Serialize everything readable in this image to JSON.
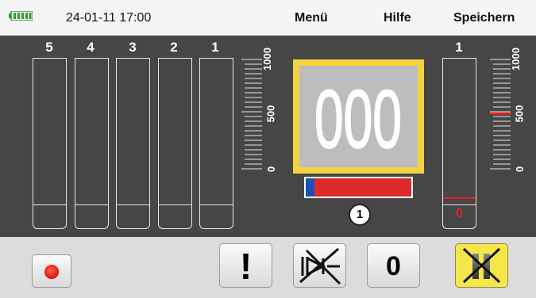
{
  "header": {
    "battery_icon": "battery-icon",
    "datetime": "24-01-11 17:00",
    "menu_label": "Menü",
    "help_label": "Hilfe",
    "save_label": "Speichern"
  },
  "left_panel": {
    "channels": [
      {
        "label": "5"
      },
      {
        "label": "4"
      },
      {
        "label": "3"
      },
      {
        "label": "2"
      },
      {
        "label": "1"
      }
    ],
    "scale": {
      "max_label": "1000",
      "mid_label": "500",
      "min_label": "0"
    }
  },
  "display": {
    "value": "000"
  },
  "progress": {
    "fraction": 0.08
  },
  "badge": {
    "label": "1"
  },
  "right_panel": {
    "channel_label": "1",
    "value": "0",
    "scale": {
      "max_label": "1000",
      "mid_label": "500",
      "min_label": "0"
    }
  },
  "toolbar": {
    "record_icon": "record-icon",
    "alert_label": "!",
    "mute_icon": "mute-icon",
    "zero_label": "0",
    "pause_icon": "pause-icon"
  },
  "colors": {
    "panel_bg": "#464646",
    "display_frame": "#f2d23e",
    "accent_red": "#e32222",
    "accent_blue": "#1e4fb8",
    "pause_bg": "#f5e64a"
  }
}
